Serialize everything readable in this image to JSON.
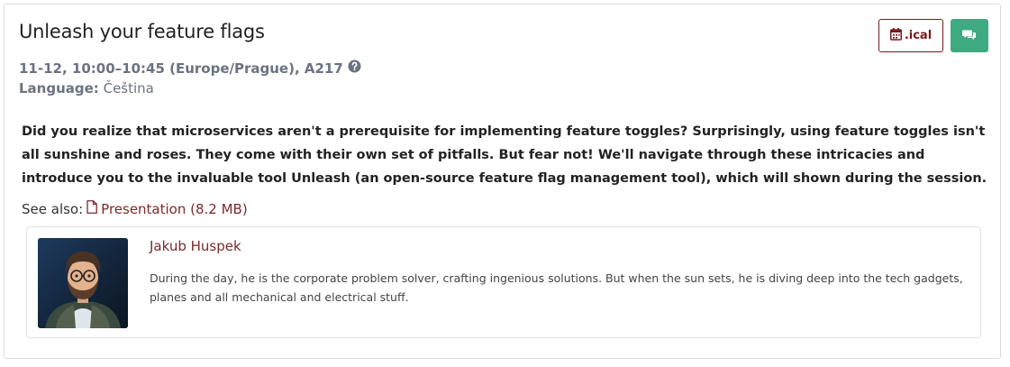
{
  "talk": {
    "title": "Unleash your feature flags",
    "schedule": "11-12, 10:00–10:45 (Europe/Prague), A217",
    "language_label": "Language:",
    "language": "Čeština",
    "description": "Did you realize that microservices aren't a prerequisite for implementing feature toggles? Surprisingly, using feature toggles isn't all sunshine and roses. They come with their own set of pitfalls. But fear not! We'll navigate through these intricacies and introduce you to the invaluable tool Unleash (an open-source feature flag management tool), which will shown during the session."
  },
  "actions": {
    "ical_label": ".ical",
    "ical_icon": "calendar-icon",
    "comment_icon": "comments-icon"
  },
  "see_also": {
    "label": "See also:",
    "link_text": "Presentation (8.2 MB)",
    "link_icon": "file-icon"
  },
  "speaker": {
    "name": "Jakub Huspek",
    "bio": "During the day, he is the corporate problem solver, crafting ingenious solutions. But when the sun sets, he is diving deep into the tech gadgets, planes and all mechanical and electrical stuff."
  },
  "colors": {
    "accent": "#7a1a1f",
    "comment_button": "#3daa82",
    "muted_text": "#6b7280"
  }
}
